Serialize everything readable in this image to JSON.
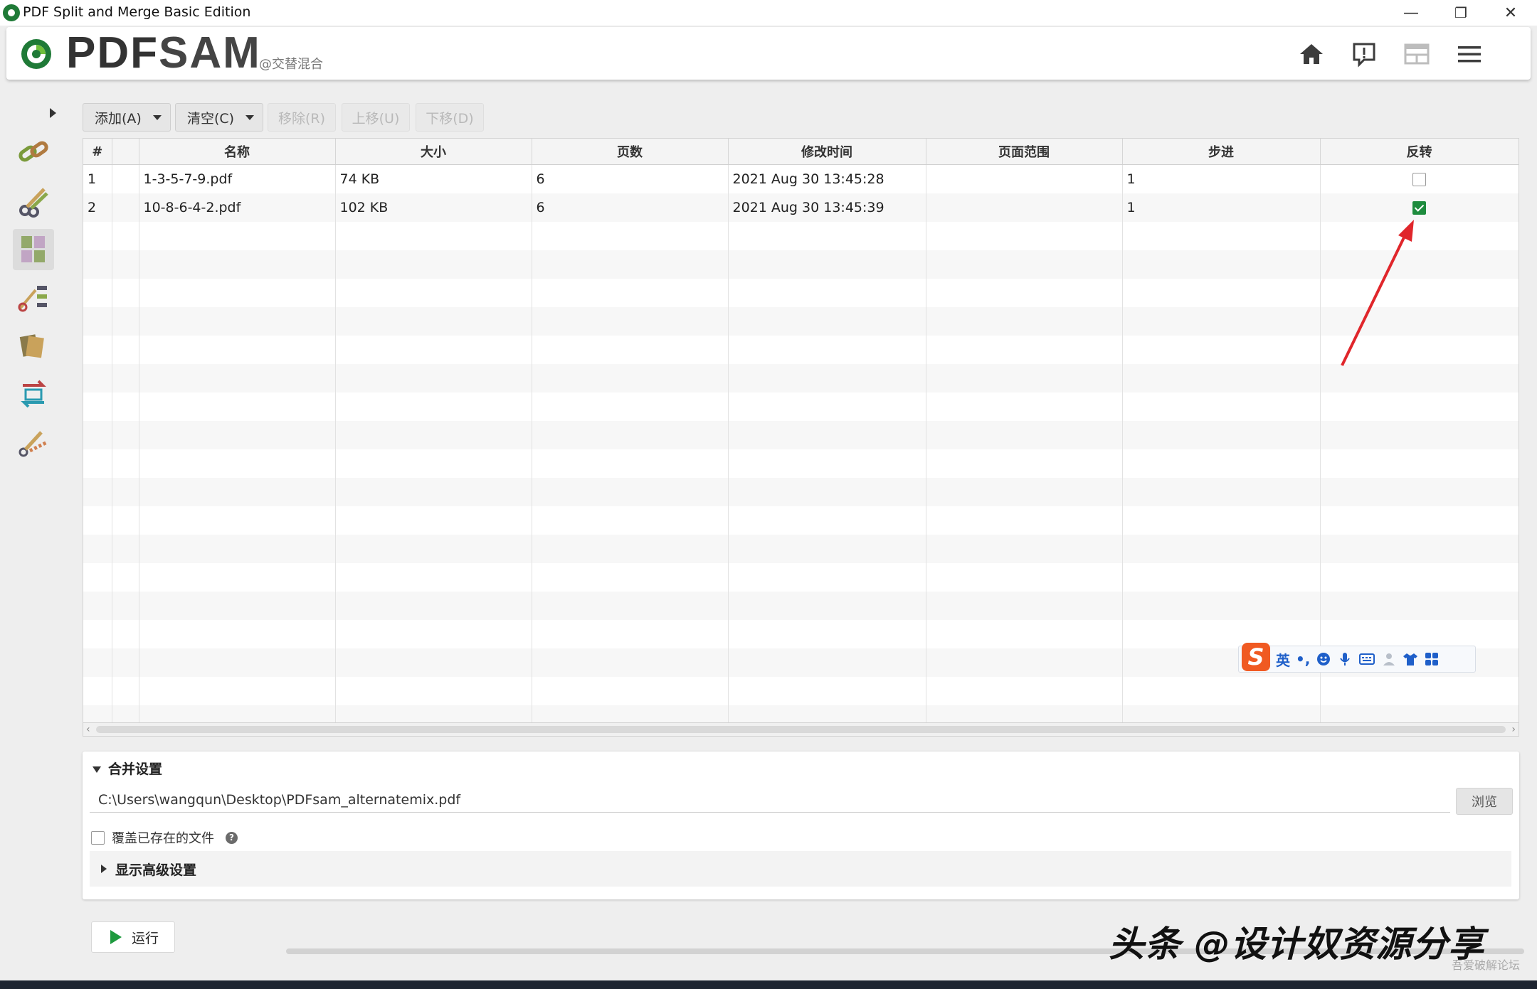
{
  "window": {
    "title": "PDF Split and Merge Basic Edition",
    "controls": [
      "—",
      "❐",
      "✕"
    ]
  },
  "header": {
    "logo_text_pdf": "PDF",
    "logo_text_sam": "SAM",
    "subtitle": "@交替混合",
    "icons": [
      "home-icon",
      "feedback-icon",
      "dashboard-icon",
      "menu-icon"
    ]
  },
  "sidebar": {
    "items": [
      {
        "name": "merge-tool-icon"
      },
      {
        "name": "split-tool-icon"
      },
      {
        "name": "alternate-mix-tool-icon",
        "active": true
      },
      {
        "name": "split-by-bookmarks-tool-icon"
      },
      {
        "name": "extract-pages-tool-icon"
      },
      {
        "name": "rotate-tool-icon"
      },
      {
        "name": "split-by-size-tool-icon"
      }
    ]
  },
  "toolbar": {
    "add_label": "添加(A)",
    "clear_label": "清空(C)",
    "remove_label": "移除(R)",
    "move_up_label": "上移(U)",
    "move_down_label": "下移(D)"
  },
  "table": {
    "headers": [
      "#",
      "",
      "名称",
      "大小",
      "页数",
      "修改时间",
      "页面范围",
      "步进",
      "反转"
    ],
    "rows": [
      {
        "index": "1",
        "name": "1-3-5-7-9.pdf",
        "size": "74 KB",
        "pages": "6",
        "modified": "2021 Aug 30 13:45:28",
        "range": "",
        "step": "1",
        "reverse": false
      },
      {
        "index": "2",
        "name": "10-8-6-4-2.pdf",
        "size": "102 KB",
        "pages": "6",
        "modified": "2021 Aug 30 13:45:39",
        "range": "",
        "step": "1",
        "reverse": true
      }
    ]
  },
  "merge_settings": {
    "title": "合并设置",
    "destination_path": "C:\\Users\\wangqun\\Desktop\\PDFsam_alternatemix.pdf",
    "browse_label": "浏览",
    "overwrite_label": "覆盖已存在的文件",
    "overwrite_checked": false,
    "advanced_label": "显示高级设置"
  },
  "run": {
    "label": "运行"
  },
  "ime_bar": {
    "logo": "S",
    "mode": "英",
    "punct": "•,"
  },
  "watermark": {
    "text": "头条 @设计奴资源分享",
    "small": "吾爱破解论坛"
  },
  "colors": {
    "accent_green": "#1e8c3e",
    "annotation_red": "#e0262b",
    "ime_orange": "#f05a22"
  }
}
